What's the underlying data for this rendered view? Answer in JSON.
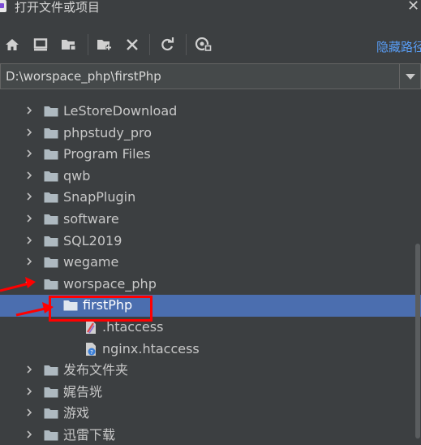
{
  "window": {
    "title": "打开文件或项目",
    "close_glyph": "✕"
  },
  "toolbar": {
    "buttons": [
      {
        "name": "home-icon"
      },
      {
        "name": "desktop-icon"
      },
      {
        "name": "project-folder-icon"
      },
      {
        "name": "new-folder-icon"
      },
      {
        "name": "delete-icon"
      },
      {
        "name": "refresh-icon"
      },
      {
        "name": "show-hidden-icon"
      }
    ],
    "hide_path_label": "隐藏路径"
  },
  "path": {
    "value": "D:\\worspace_php\\firstPhp"
  },
  "tree": {
    "items": [
      {
        "label": "LeStoreDownload",
        "depth": 0,
        "type": "folder",
        "expanded": false
      },
      {
        "label": "phpstudy_pro",
        "depth": 0,
        "type": "folder",
        "expanded": false
      },
      {
        "label": "Program Files",
        "depth": 0,
        "type": "folder",
        "expanded": false
      },
      {
        "label": "qwb",
        "depth": 0,
        "type": "folder",
        "expanded": false
      },
      {
        "label": "SnapPlugin",
        "depth": 0,
        "type": "folder",
        "expanded": false
      },
      {
        "label": "software",
        "depth": 0,
        "type": "folder",
        "expanded": false
      },
      {
        "label": "SQL2019",
        "depth": 0,
        "type": "folder",
        "expanded": false
      },
      {
        "label": "wegame",
        "depth": 0,
        "type": "folder",
        "expanded": false
      },
      {
        "label": "worspace_php",
        "depth": 0,
        "type": "folder",
        "expanded": true
      },
      {
        "label": "firstPhp",
        "depth": 1,
        "type": "folder",
        "selected": true
      },
      {
        "label": ".htaccess",
        "depth": 2,
        "type": "htaccess"
      },
      {
        "label": "nginx.htaccess",
        "depth": 2,
        "type": "unknown-file"
      },
      {
        "label": "发布文件夹",
        "depth": 0,
        "type": "folder",
        "expanded": false
      },
      {
        "label": "娓告垙",
        "depth": 0,
        "type": "folder",
        "expanded": false
      },
      {
        "label": "游戏",
        "depth": 0,
        "type": "folder",
        "expanded": false
      },
      {
        "label": "迅雷下载",
        "depth": 0,
        "type": "folder",
        "expanded": false
      }
    ]
  },
  "colors": {
    "background": "#3c3f41",
    "selection": "#4b6eaf",
    "link": "#589df6",
    "annotation": "#ff0000"
  }
}
